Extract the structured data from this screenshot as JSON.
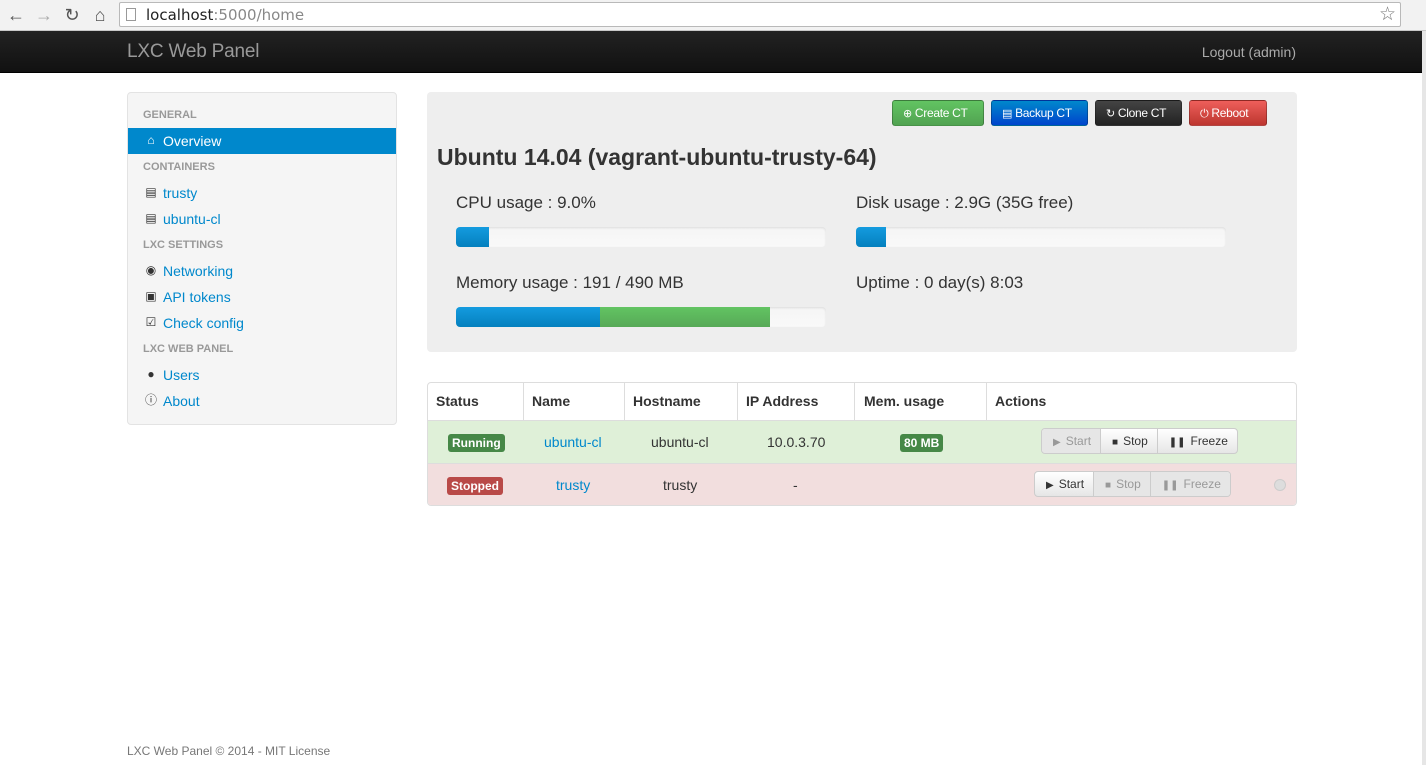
{
  "browser": {
    "url_host": "localhost",
    "url_path": ":5000/home"
  },
  "navbar": {
    "brand": "LXC Web Panel",
    "logout": "Logout (admin)"
  },
  "sidebar": {
    "sections": [
      "GENERAL",
      "CONTAINERS",
      "LXC SETTINGS",
      "LXC WEB PANEL"
    ],
    "items": [
      {
        "label": "Overview",
        "icon": "home-icon"
      },
      {
        "label": "trusty",
        "icon": "server-icon"
      },
      {
        "label": "ubuntu-cl",
        "icon": "server-icon"
      },
      {
        "label": "Networking",
        "icon": "globe-icon"
      },
      {
        "label": "API tokens",
        "icon": "lock-icon"
      },
      {
        "label": "Check config",
        "icon": "check-icon"
      },
      {
        "label": "Users",
        "icon": "user-icon"
      },
      {
        "label": "About",
        "icon": "info-icon"
      }
    ]
  },
  "toolbar": {
    "create": "Create CT",
    "backup": "Backup CT",
    "clone": "Clone CT",
    "reboot": "Reboot"
  },
  "host": {
    "title": "Ubuntu 14.04 (vagrant-ubuntu-trusty-64)",
    "cpu": "CPU usage : 9.0%",
    "disk": "Disk usage : 2.9G (35G free)",
    "memory": "Memory usage : 191 / 490 MB",
    "uptime": "Uptime : 0 day(s) 8:03",
    "cpu_fraction": 0.09,
    "disk_fraction": 0.08,
    "memory_used_fraction": 0.39,
    "memory_cached_fraction": 0.46
  },
  "table": {
    "headers": [
      "Status",
      "Name",
      "Hostname",
      "IP Address",
      "Mem. usage",
      "Actions"
    ],
    "rows": [
      {
        "status": "Running",
        "name": "ubuntu-cl",
        "hostname": "ubuntu-cl",
        "ip": "10.0.3.70",
        "mem": "80 MB",
        "start": "Start",
        "stop": "Stop",
        "freeze": "Freeze"
      },
      {
        "status": "Stopped",
        "name": "trusty",
        "hostname": "trusty",
        "ip": "-",
        "mem": "",
        "start": "Start",
        "stop": "Stop",
        "freeze": "Freeze"
      }
    ]
  },
  "colors": {
    "link": "#0088cc",
    "running": "#468847",
    "stopped": "#b94a48",
    "progress_blue": "#149bdf",
    "progress_green": "#62c462"
  },
  "footer": "LXC Web Panel © 2014 - MIT License"
}
